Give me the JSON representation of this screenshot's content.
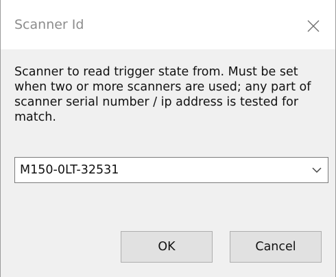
{
  "dialog": {
    "title": "Scanner Id",
    "close_icon": "close-icon",
    "description": "Scanner to read trigger state from. Must be set when two or more scanners are used; any part of scanner serial number / ip address is tested for match.",
    "scanner_select": {
      "value": "M150-0LT-32531",
      "icon": "chevron-down-icon"
    },
    "ok_label": "OK",
    "cancel_label": "Cancel"
  }
}
